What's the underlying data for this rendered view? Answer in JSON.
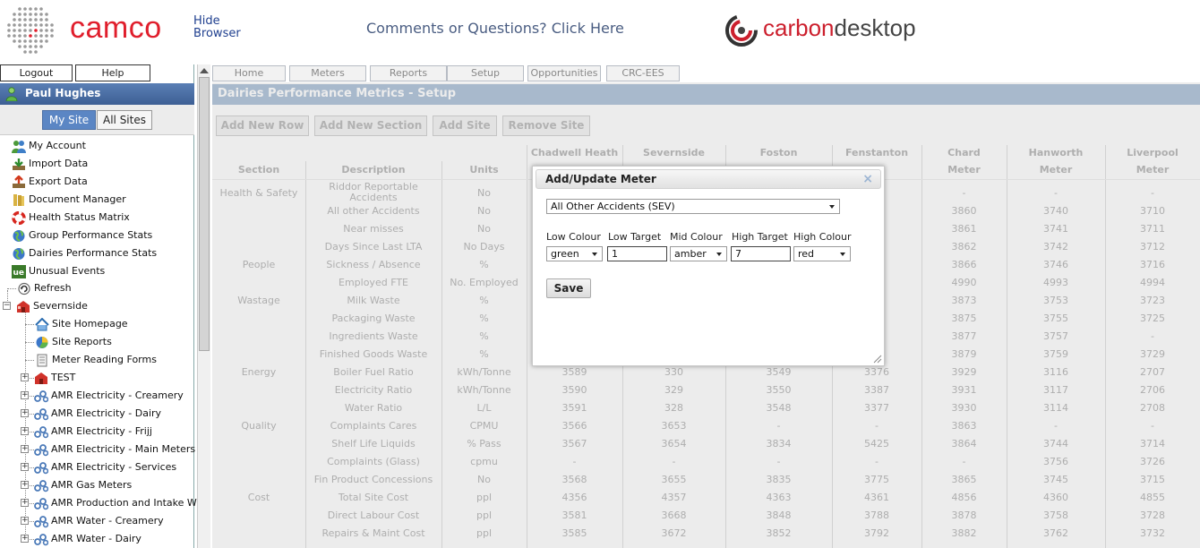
{
  "header": {
    "brand": "camco",
    "hide_browser": [
      "Hide",
      "Browser"
    ],
    "comments_link": "Comments or Questions? Click Here",
    "product_brand_bold": "carbon",
    "product_brand_light": "desktop"
  },
  "sidebar": {
    "logout": "Logout",
    "help": "Help",
    "user_name": "Paul Hughes",
    "my_site": "My Site",
    "all_sites": "All Sites",
    "menu": [
      {
        "label": "My Account",
        "icon": "users-icon"
      },
      {
        "label": "Import Data",
        "icon": "import-icon"
      },
      {
        "label": "Export Data",
        "icon": "export-icon"
      },
      {
        "label": "Document Manager",
        "icon": "books-icon"
      },
      {
        "label": "Health Status Matrix",
        "icon": "lifebuoy-icon"
      },
      {
        "label": "Group Performance Stats",
        "icon": "globe-icon"
      },
      {
        "label": "Dairies Performance Stats",
        "icon": "globe-icon"
      },
      {
        "label": "Unusual Events",
        "icon": "ue-icon"
      }
    ],
    "tree": [
      {
        "label": "Refresh",
        "icon": "refresh-icon"
      },
      {
        "label": "Severnside",
        "icon": "site-icon"
      },
      {
        "label": "Site Homepage",
        "icon": "home-icon"
      },
      {
        "label": "Site Reports",
        "icon": "reports-icon"
      },
      {
        "label": "Meter Reading Forms",
        "icon": "form-icon"
      },
      {
        "label": "TEST",
        "icon": "site-icon"
      },
      {
        "label": "AMR Electricity - Creamery",
        "icon": "meter-group-icon"
      },
      {
        "label": "AMR Electricity - Dairy",
        "icon": "meter-group-icon"
      },
      {
        "label": "AMR Electricity - Frijj",
        "icon": "meter-group-icon"
      },
      {
        "label": "AMR Electricity - Main Meters",
        "icon": "meter-group-icon"
      },
      {
        "label": "AMR Electricity - Services",
        "icon": "meter-group-icon"
      },
      {
        "label": "AMR Gas Meters",
        "icon": "meter-group-icon"
      },
      {
        "label": "AMR Production and Intake WIP",
        "icon": "meter-group-icon"
      },
      {
        "label": "AMR Water - Creamery",
        "icon": "meter-group-icon"
      },
      {
        "label": "AMR Water - Dairy",
        "icon": "meter-group-icon"
      }
    ]
  },
  "tabs": [
    "Home",
    "Meters",
    "Reports",
    "Setup",
    "Opportunities",
    "CRC-EES"
  ],
  "page_title": "Dairies Performance Metrics - Setup",
  "actions": [
    "Add New Row",
    "Add New Section",
    "Add Site",
    "Remove Site"
  ],
  "table": {
    "site_headers": [
      "Chadwell Heath",
      "Severnside",
      "Foston",
      "Fenstanton",
      "Chard",
      "Hanworth",
      "Liverpool"
    ],
    "col_headers": [
      "Section",
      "Description",
      "Units",
      "",
      "",
      "",
      "",
      "Meter",
      "Meter",
      "Meter"
    ],
    "rows": [
      [
        "Health & Safety",
        "Riddor Reportable Accidents",
        "No",
        "",
        "",
        "",
        "",
        "-",
        "-",
        "-"
      ],
      [
        "",
        "All other Accidents",
        "No",
        "",
        "",
        "",
        "",
        "3860",
        "3740",
        "3710"
      ],
      [
        "",
        "Near misses",
        "No",
        "",
        "",
        "",
        "",
        "3861",
        "3741",
        "3711"
      ],
      [
        "",
        "Days Since Last LTA",
        "No Days",
        "",
        "",
        "",
        "",
        "3862",
        "3742",
        "3712"
      ],
      [
        "People",
        "Sickness / Absence",
        "%",
        "",
        "",
        "",
        "",
        "3866",
        "3746",
        "3716"
      ],
      [
        "",
        "Employed FTE",
        "No. Employed",
        "",
        "",
        "",
        "",
        "4990",
        "4993",
        "4994"
      ],
      [
        "Wastage",
        "Milk Waste",
        "%",
        "",
        "",
        "",
        "",
        "3873",
        "3753",
        "3723"
      ],
      [
        "",
        "Packaging Waste",
        "%",
        "",
        "",
        "",
        "",
        "3875",
        "3755",
        "3725"
      ],
      [
        "",
        "Ingredients Waste",
        "%",
        "",
        "",
        "",
        "",
        "3877",
        "3757",
        "-"
      ],
      [
        "",
        "Finished Goods Waste",
        "%",
        "",
        "",
        "",
        "",
        "3879",
        "3759",
        "3729"
      ],
      [
        "Energy",
        "Boiler Fuel Ratio",
        "kWh/Tonne",
        "3589",
        "330",
        "3549",
        "3376",
        "3929",
        "3116",
        "2707"
      ],
      [
        "",
        "Electricity Ratio",
        "kWh/Tonne",
        "3590",
        "329",
        "3550",
        "3387",
        "3931",
        "3117",
        "2706"
      ],
      [
        "",
        "Water Ratio",
        "L/L",
        "3591",
        "328",
        "3548",
        "3377",
        "3930",
        "3114",
        "2708"
      ],
      [
        "Quality",
        "Complaints Cares",
        "CPMU",
        "3566",
        "3653",
        "-",
        "-",
        "3863",
        "-",
        "-"
      ],
      [
        "",
        "Shelf Life Liquids",
        "% Pass",
        "3567",
        "3654",
        "3834",
        "5425",
        "3864",
        "3744",
        "3714"
      ],
      [
        "",
        "Complaints (Glass)",
        "cpmu",
        "-",
        "-",
        "-",
        "-",
        "-",
        "3756",
        "3726"
      ],
      [
        "",
        "Fin Product Concessions",
        "No",
        "3568",
        "3655",
        "3835",
        "3775",
        "3865",
        "3745",
        "3715"
      ],
      [
        "Cost",
        "Total Site Cost",
        "ppl",
        "4356",
        "4357",
        "4363",
        "4361",
        "4856",
        "4360",
        "4855"
      ],
      [
        "",
        "Direct Labour Cost",
        "ppl",
        "3581",
        "3668",
        "3848",
        "3788",
        "3878",
        "3758",
        "3728"
      ],
      [
        "",
        "Repairs & Maint Cost",
        "ppl",
        "3585",
        "3672",
        "3852",
        "3792",
        "3882",
        "3762",
        "3732"
      ]
    ]
  },
  "dialog": {
    "title": "Add/Update Meter",
    "close": "×",
    "meter_select": "All Other Accidents (SEV)",
    "labels": [
      "Low Colour",
      "Low Target",
      "Mid Colour",
      "High Target",
      "High Colour"
    ],
    "low_colour": "green",
    "low_target": "1",
    "mid_colour": "amber",
    "high_target": "7",
    "high_colour": "red",
    "save": "Save"
  }
}
